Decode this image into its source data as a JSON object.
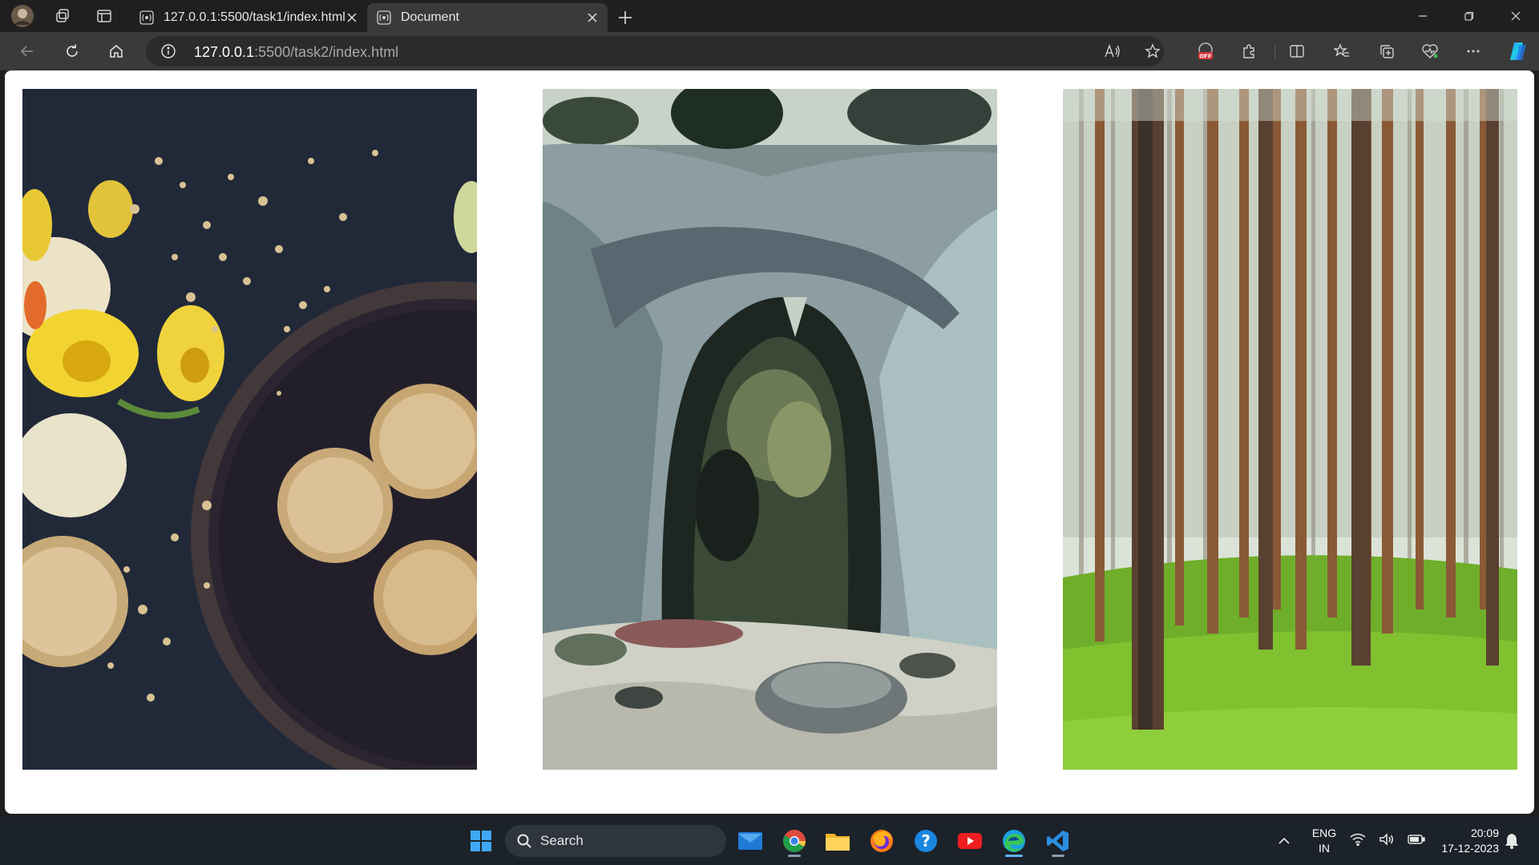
{
  "browser": {
    "tabs": [
      {
        "title": "127.0.0.1:5500/task1/index.html",
        "active": false
      },
      {
        "title": "Document",
        "active": true
      }
    ],
    "address": {
      "host": "127.0.0.1",
      "rest": ":5500/task2/index.html"
    },
    "window_controls": [
      "minimize-icon",
      "restore-icon",
      "close-icon"
    ]
  },
  "page": {
    "images": [
      {
        "name": "cookies-and-daffodils-photo"
      },
      {
        "name": "rock-arch-photo"
      },
      {
        "name": "pine-forest-photo"
      }
    ]
  },
  "taskbar": {
    "search_label": "Search",
    "language": {
      "line1": "ENG",
      "line2": "IN"
    },
    "clock": {
      "time": "20:09",
      "date": "17-12-2023"
    }
  },
  "colors": {
    "accent": "#0078d4",
    "titlebar": "#1f1f1f",
    "toolbar": "#3a3a3a",
    "taskbar": "#1c2229"
  }
}
